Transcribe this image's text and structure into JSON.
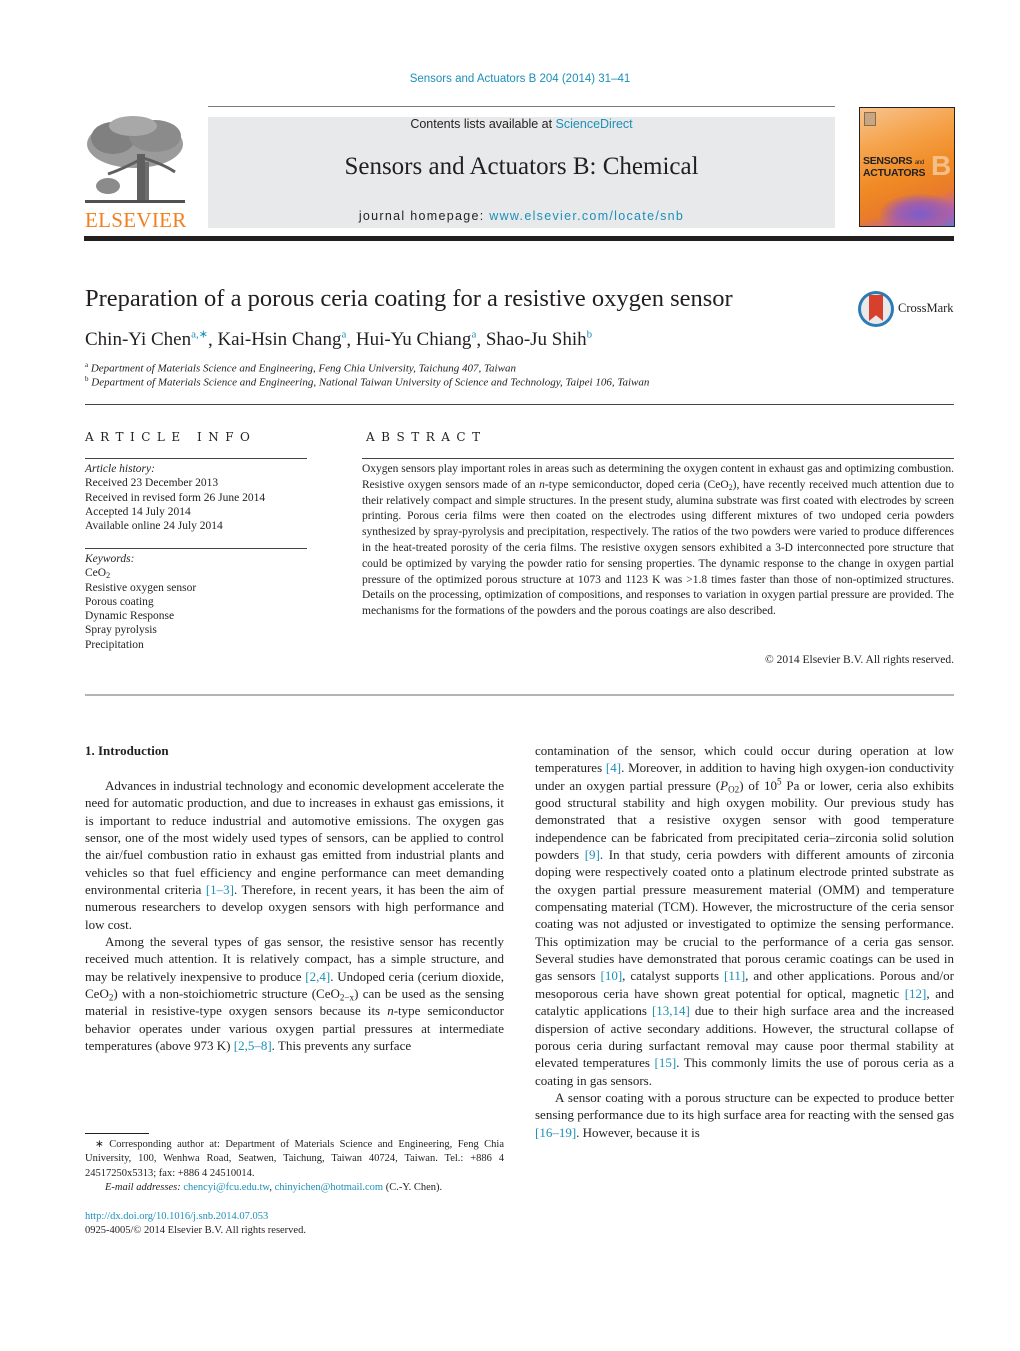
{
  "header": {
    "journal_ref": "Sensors and Actuators B 204 (2014) 31–41",
    "contents_prefix": "Contents lists available at ",
    "contents_link": "ScienceDirect",
    "journal_title": "Sensors and Actuators B: Chemical",
    "homepage_prefix": "journal homepage: ",
    "homepage_link": "www.elsevier.com/locate/snb",
    "publisher_logo_text": "ELSEVIER",
    "cover": {
      "line1": "SENSORS",
      "line1_small": "and",
      "line2": "ACTUATORS",
      "letter": "B"
    },
    "colors": {
      "link": "#1d8fb8",
      "elsevier_orange": "#f07f1e",
      "banner_bg": "#e8e9ea"
    }
  },
  "article": {
    "title": "Preparation of a porous ceria coating for a resistive oxygen sensor",
    "crossmark_label": "CrossMark",
    "authors": [
      {
        "name": "Chin-Yi Chen",
        "sup": "a,∗",
        "sep": ", "
      },
      {
        "name": "Kai-Hsin Chang",
        "sup": "a",
        "sep": ", "
      },
      {
        "name": "Hui-Yu Chiang",
        "sup": "a",
        "sep": ", "
      },
      {
        "name": "Shao-Ju Shih",
        "sup": "b",
        "sep": ""
      }
    ],
    "affiliations": [
      {
        "key": "a",
        "text": "Department of Materials Science and Engineering, Feng Chia University, Taichung 407, Taiwan"
      },
      {
        "key": "b",
        "text": "Department of Materials Science and Engineering, National Taiwan University of Science and Technology, Taipei 106, Taiwan"
      }
    ]
  },
  "article_info": {
    "heading": "ARTICLE INFO",
    "history_label": "Article history:",
    "history": [
      "Received 23 December 2013",
      "Received in revised form 26 June 2014",
      "Accepted 14 July 2014",
      "Available online 24 July 2014"
    ],
    "keywords_label": "Keywords:",
    "keywords": [
      "CeO2",
      "Resistive oxygen sensor",
      "Porous coating",
      "Dynamic Response",
      "Spray pyrolysis",
      "Precipitation"
    ]
  },
  "abstract": {
    "heading": "ABSTRACT",
    "text_1": "Oxygen sensors play important roles in areas such as determining the oxygen content in exhaust gas and optimizing combustion. Resistive oxygen sensors made of an ",
    "text_n": "n",
    "text_2": "-type semiconductor, doped ceria (CeO",
    "text_sub": "2",
    "text_3": "), have recently received much attention due to their relatively compact and simple structures. In the present study, alumina substrate was first coated with electrodes by screen printing. Porous ceria films were then coated on the electrodes using different mixtures of two undoped ceria powders synthesized by spray-pyrolysis and precipitation, respectively. The ratios of the two powders were varied to produce differences in the heat-treated porosity of the ceria films. The resistive oxygen sensors exhibited a 3-D interconnected pore structure that could be optimized by varying the powder ratio for sensing properties. The dynamic response to the change in oxygen partial pressure of the optimized porous structure at 1073 and 1123 K was >1.8 times faster than those of non-optimized structures. Details on the processing, optimization of compositions, and responses to variation in oxygen partial pressure are provided. The mechanisms for the formations of the powders and the porous coatings are also described.",
    "copyright": "© 2014 Elsevier B.V. All rights reserved."
  },
  "body": {
    "section_heading": "1.  Introduction",
    "left_p1_a": "Advances in industrial technology and economic development accelerate the need for automatic production, and due to increases in exhaust gas emissions, it is important to reduce industrial and automotive emissions. The oxygen gas sensor, one of the most widely used types of sensors, can be applied to control the air/fuel combustion ratio in exhaust gas emitted from industrial plants and vehicles so that fuel efficiency and engine performance can meet demanding environmental criteria ",
    "left_p1_ref1": "[1–3]",
    "left_p1_b": ". Therefore, in recent years, it has been the aim of numerous researchers to develop oxygen sensors with high performance and low cost.",
    "left_p2_a": "Among the several types of gas sensor, the resistive sensor has recently received much attention. It is relatively compact, has a simple structure, and may be relatively inexpensive to produce ",
    "left_p2_ref1": "[2,4]",
    "left_p2_b": ". Undoped ceria (cerium dioxide, CeO",
    "left_p2_sub1": "2",
    "left_p2_c": ") with a non-stoichiometric structure (CeO",
    "left_p2_sub2": "2−x",
    "left_p2_d": ") can be used as the sensing material in resistive-type oxygen sensors because its ",
    "left_p2_n": "n",
    "left_p2_e": "-type semiconductor behavior operates under various oxygen partial pressures at intermediate temperatures (above 973 K) ",
    "left_p2_ref2": "[2,5–8]",
    "left_p2_f": ". This prevents any surface",
    "right_p1_a": "contamination of the sensor, which could occur during operation at low temperatures ",
    "right_p1_ref1": "[4]",
    "right_p1_b": ". Moreover, in addition to having high oxygen-ion conductivity under an oxygen partial pressure (",
    "right_p1_P": "P",
    "right_p1_Psub": "O2",
    "right_p1_c": ") of 10",
    "right_p1_sup": "5",
    "right_p1_d": " Pa or lower, ceria also exhibits good structural stability and high oxygen mobility. Our previous study has demonstrated that a resistive oxygen sensor with good temperature independence can be fabricated from precipitated ceria–zirconia solid solution powders ",
    "right_p1_ref2": "[9]",
    "right_p1_e": ". In that study, ceria powders with different amounts of zirconia doping were respectively coated onto a platinum electrode printed substrate as the oxygen partial pressure measurement material (OMM) and temperature compensating material (TCM). However, the microstructure of the ceria sensor coating was not adjusted or investigated to optimize the sensing performance. This optimization may be crucial to the performance of a ceria gas sensor. Several studies have demonstrated that porous ceramic coatings can be used in gas sensors ",
    "right_p1_ref3": "[10]",
    "right_p1_f": ", catalyst supports ",
    "right_p1_ref4": "[11]",
    "right_p1_g": ", and other applications. Porous and/or mesoporous ceria have shown great potential for optical, magnetic ",
    "right_p1_ref5": "[12]",
    "right_p1_h": ", and catalytic applications ",
    "right_p1_ref6": "[13,14]",
    "right_p1_i": " due to their high surface area and the increased dispersion of active secondary additions. However, the structural collapse of porous ceria during surfactant removal may cause poor thermal stability at elevated temperatures ",
    "right_p1_ref7": "[15]",
    "right_p1_j": ". This commonly limits the use of porous ceria as a coating in gas sensors.",
    "right_p2_a": "A sensor coating with a porous structure can be expected to produce better sensing performance due to its high surface area for reacting with the sensed gas ",
    "right_p2_ref1": "[16–19]",
    "right_p2_b": ". However, because it is"
  },
  "footnotes": {
    "corr_star": "∗",
    "corr_text": " Corresponding author at: Department of Materials Science and Engineering, Feng Chia University, 100, Wenhwa Road, Seatwen, Taichung, Taiwan 40724, Taiwan. Tel.: +886 4 24517250x5313; fax: +886 4 24510014.",
    "email_label": "E-mail addresses: ",
    "email_1": "chencyi@fcu.edu.tw",
    "email_sep": ", ",
    "email_2": "chinyichen@hotmail.com",
    "email_suffix": " (C.-Y. Chen).",
    "doi": "http://dx.doi.org/10.1016/j.snb.2014.07.053",
    "issn": "0925-4005/© 2014 Elsevier B.V. All rights reserved."
  }
}
